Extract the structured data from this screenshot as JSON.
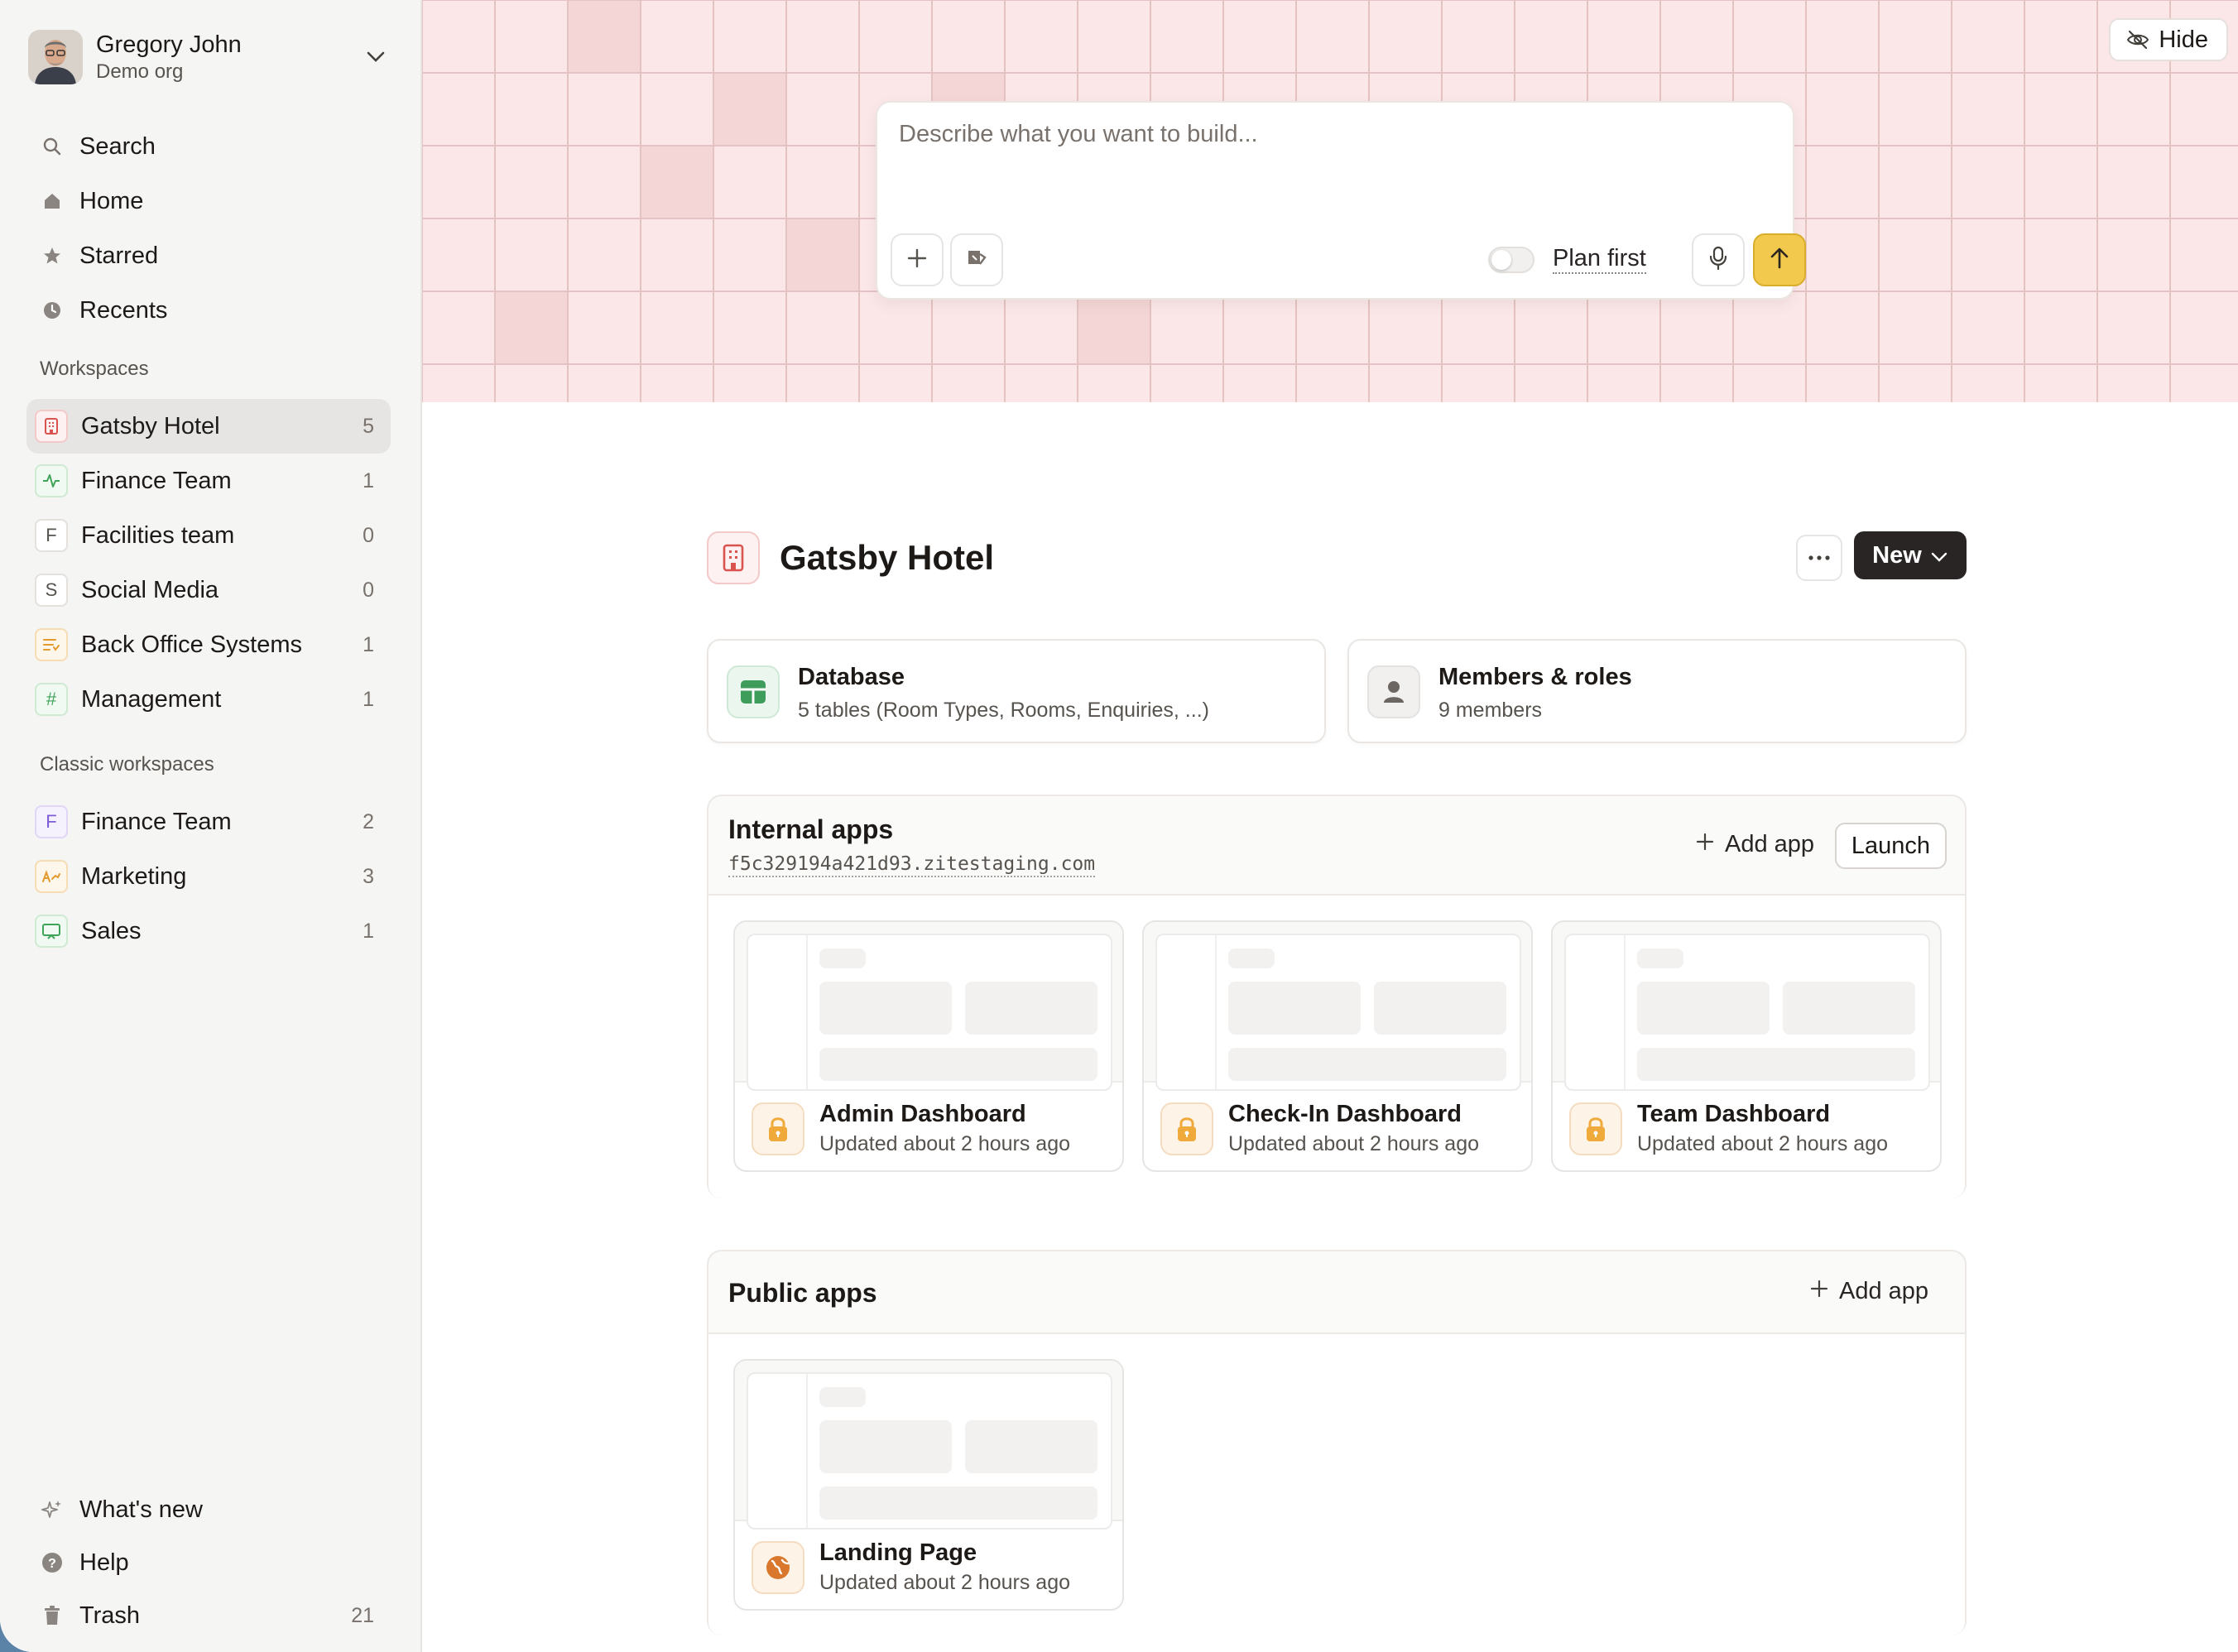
{
  "user": {
    "name": "Gregory John",
    "org": "Demo org"
  },
  "nav": [
    {
      "label": "Search",
      "icon": "search-icon"
    },
    {
      "label": "Home",
      "icon": "home-icon"
    },
    {
      "label": "Starred",
      "icon": "star-icon"
    },
    {
      "label": "Recents",
      "icon": "clock-icon"
    }
  ],
  "workspaces_label": "Workspaces",
  "workspaces": [
    {
      "name": "Gatsby Hotel",
      "count": "5",
      "badge": "building-icon",
      "active": true
    },
    {
      "name": "Finance Team",
      "count": "1",
      "badge": "activity-icon"
    },
    {
      "name": "Facilities team",
      "count": "0",
      "badge": "F"
    },
    {
      "name": "Social Media",
      "count": "0",
      "badge": "S"
    },
    {
      "name": "Back Office Systems",
      "count": "1",
      "badge": "list-icon"
    },
    {
      "name": "Management",
      "count": "1",
      "badge": "#"
    }
  ],
  "classic_label": "Classic workspaces",
  "classic_workspaces": [
    {
      "name": "Finance Team",
      "count": "2",
      "badge": "F"
    },
    {
      "name": "Marketing",
      "count": "3",
      "badge": "A"
    },
    {
      "name": "Sales",
      "count": "1",
      "badge": "presentation-icon"
    }
  ],
  "bottom_nav": [
    {
      "label": "What's new",
      "icon": "sparkle-icon"
    },
    {
      "label": "Help",
      "icon": "help-icon"
    },
    {
      "label": "Trash",
      "icon": "trash-icon",
      "count": "21"
    }
  ],
  "hide_label": "Hide",
  "prompt": {
    "placeholder": "Describe what you want to build...",
    "plan_first": "Plan first"
  },
  "workspace": {
    "title": "Gatsby Hotel",
    "new_label": "New"
  },
  "cards": {
    "database": {
      "title": "Database",
      "subtitle": "5 tables (Room Types, Rooms, Enquiries, ...)"
    },
    "members": {
      "title": "Members & roles",
      "subtitle": "9 members"
    }
  },
  "internal_apps": {
    "title": "Internal apps",
    "url": "f5c329194a421d93.zitestaging.com",
    "add_label": "Add app",
    "launch_label": "Launch",
    "apps": [
      {
        "name": "Admin Dashboard",
        "updated": "Updated about 2 hours ago"
      },
      {
        "name": "Check-In Dashboard",
        "updated": "Updated about 2 hours ago"
      },
      {
        "name": "Team Dashboard",
        "updated": "Updated about 2 hours ago"
      }
    ]
  },
  "public_apps": {
    "title": "Public apps",
    "add_label": "Add app",
    "apps": [
      {
        "name": "Landing Page",
        "updated": "Updated about 2 hours ago"
      }
    ]
  },
  "colors": {
    "accent_yellow": "#f2c94c",
    "grid_pink": "#fbe7e7",
    "sidebar_bg": "#f5f5f4",
    "dark_button": "#292524"
  }
}
